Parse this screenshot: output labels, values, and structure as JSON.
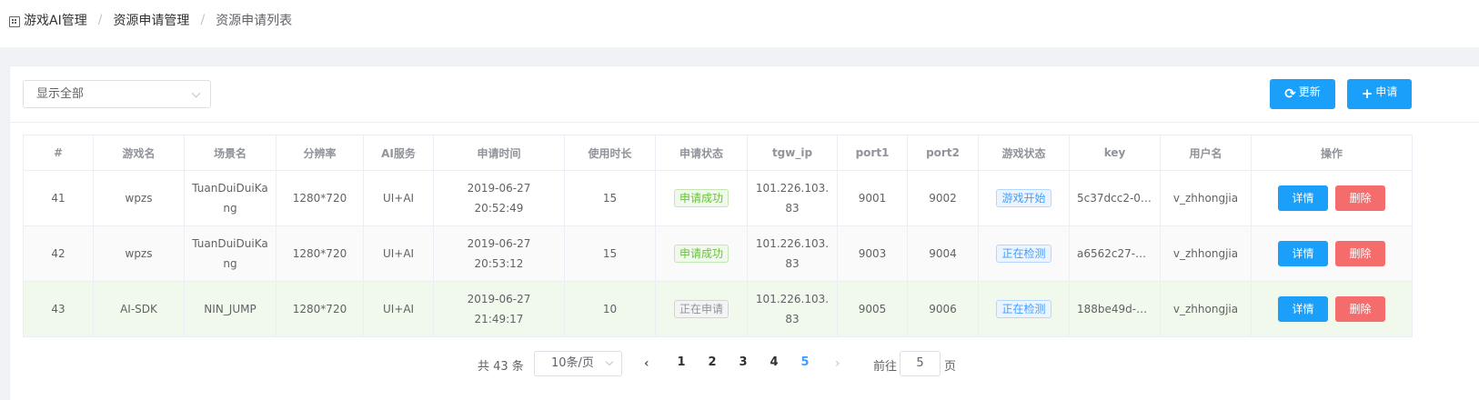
{
  "breadcrumb": {
    "items": [
      "游戏AI管理",
      "资源申请管理",
      "资源申请列表"
    ],
    "separator": "/"
  },
  "filter": {
    "selected": "显示全部"
  },
  "toolbar": {
    "refresh_label": "更新",
    "apply_label": "申请"
  },
  "table": {
    "headers": [
      "#",
      "游戏名",
      "场景名",
      "分辨率",
      "AI服务",
      "申请时间",
      "使用时长",
      "申请状态",
      "tgw_ip",
      "port1",
      "port2",
      "游戏状态",
      "key",
      "用户名",
      "操作"
    ],
    "rows": [
      {
        "id": "41",
        "game": "wpzs",
        "scene": "TuanDuiDuiKang",
        "resolution": "1280*720",
        "ai_service": "UI+AI",
        "apply_time": "2019-06-27 20:52:49",
        "duration": "15",
        "apply_status": "申请成功",
        "tgw_ip": "101.226.103.83",
        "port1": "9001",
        "port2": "9002",
        "game_status": "游戏开始",
        "key": "5c37dcc2-00…",
        "user": "v_zhhongjia"
      },
      {
        "id": "42",
        "game": "wpzs",
        "scene": "TuanDuiDuiKang",
        "resolution": "1280*720",
        "ai_service": "UI+AI",
        "apply_time": "2019-06-27 20:53:12",
        "duration": "15",
        "apply_status": "申请成功",
        "tgw_ip": "101.226.103.83",
        "port1": "9003",
        "port2": "9004",
        "game_status": "正在检测",
        "key": "a6562c27-8b…",
        "user": "v_zhhongjia"
      },
      {
        "id": "43",
        "game": "AI-SDK",
        "scene": "NIN_JUMP",
        "resolution": "1280*720",
        "ai_service": "UI+AI",
        "apply_time": "2019-06-27 21:49:17",
        "duration": "10",
        "apply_status": "正在申请",
        "tgw_ip": "101.226.103.83",
        "port1": "9005",
        "port2": "9006",
        "game_status": "正在检测",
        "key": "188be49d-a6…",
        "user": "v_zhhongjia"
      }
    ],
    "actions": {
      "detail_label": "详情",
      "delete_label": "删除"
    }
  },
  "pagination": {
    "total_text": "共 43 条",
    "page_size": "10条/页",
    "pages": [
      "1",
      "2",
      "3",
      "4",
      "5"
    ],
    "current_page": "5",
    "goto_label": "前往",
    "goto_value": "5",
    "goto_suffix": "页",
    "prev_icon": "chevron-left-icon",
    "next_icon": "chevron-right-icon"
  },
  "colors": {
    "primary": "#1a9ffb",
    "danger": "#f56c6c",
    "success": "#67c23a",
    "info": "#909399",
    "active_page": "#409eff"
  }
}
